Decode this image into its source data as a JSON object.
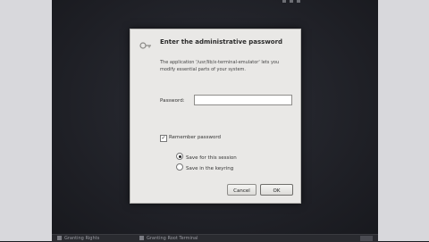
{
  "dialog": {
    "title": "Enter the administrative password",
    "description": "The application '/usr/lib/x-terminal-emulator' lets you modify essential parts of your system.",
    "password_label": "Password:",
    "password_value": "",
    "remember_label": "Remember password",
    "remember_checked": true,
    "options": [
      {
        "label": "Save for this session",
        "selected": true
      },
      {
        "label": "Save in the keyring",
        "selected": false
      }
    ],
    "cancel_label": "Cancel",
    "ok_label": "OK"
  },
  "taskbar": {
    "items": [
      {
        "label": "Granting Rights"
      },
      {
        "label": "Granting Root Terminal"
      }
    ]
  },
  "icons": {
    "dialog_icon": "key-icon",
    "check_mark": "✓"
  }
}
